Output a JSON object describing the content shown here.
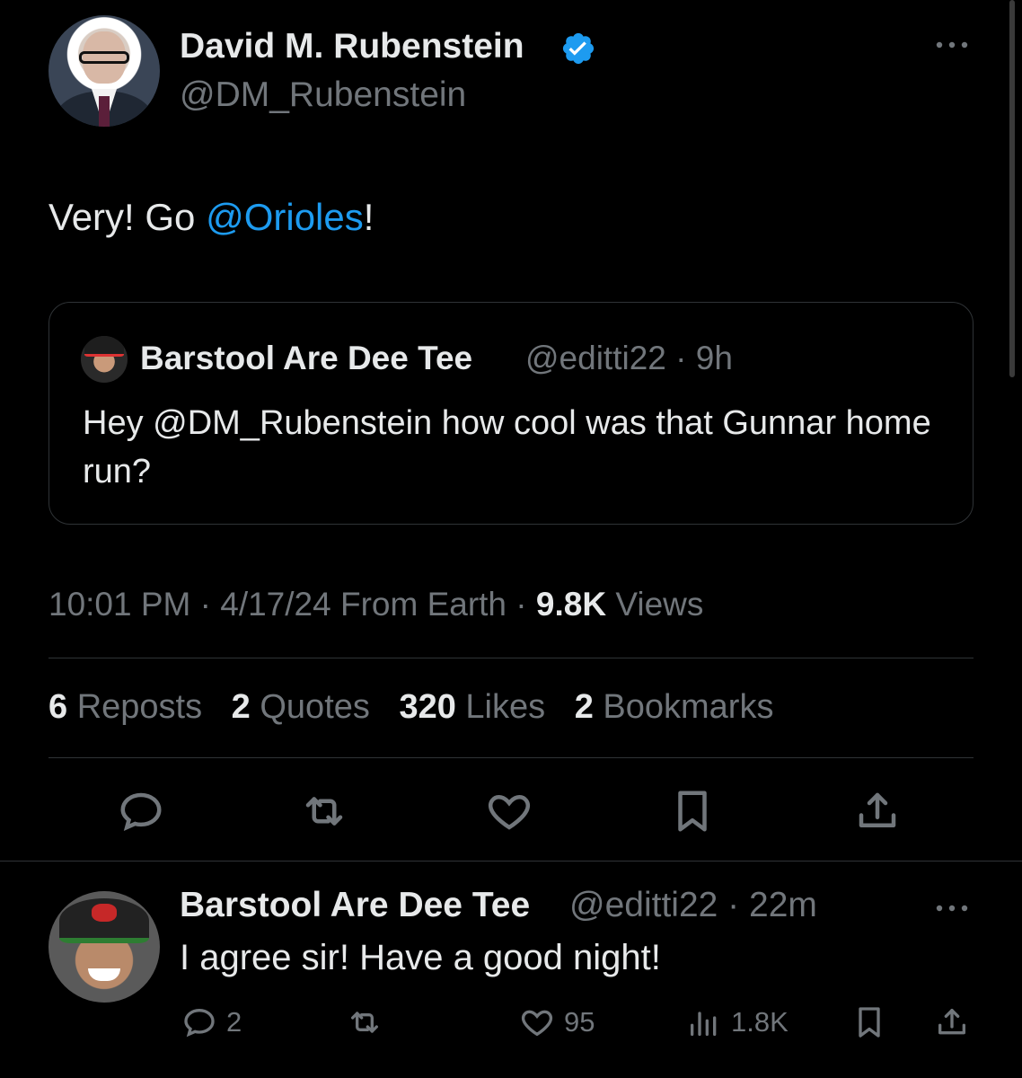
{
  "tweet": {
    "author_name": "David M. Rubenstein",
    "author_handle": "@DM_Rubenstein",
    "text_before": "Very! Go ",
    "text_mention": "@Orioles",
    "text_after": "!",
    "timestamp": "10:01 PM · 4/17/24 From Earth · ",
    "views_count": "9.8K",
    "views_label": " Views",
    "verified_color": "#1d9bf0"
  },
  "quote": {
    "author_name": "Barstool Are Dee Tee",
    "author_meta": "@editti22 · 9h",
    "text": "Hey @DM_Rubenstein how cool was that Gunnar home run?"
  },
  "stats": {
    "reposts_count": "6",
    "reposts_label": " Reposts",
    "quotes_count": "2",
    "quotes_label": " Quotes",
    "likes_count": "320",
    "likes_label": " Likes",
    "bookmarks_count": "2",
    "bookmarks_label": " Bookmarks"
  },
  "actions": [
    "reply-icon",
    "repost-icon",
    "like-icon",
    "bookmark-icon",
    "share-icon"
  ],
  "reply": {
    "author_name": "Barstool Are Dee Tee",
    "author_meta": "@editti22 · 22m",
    "text": "I agree sir! Have a good night!",
    "reply_count": "2",
    "like_count": "95",
    "view_count": "1.8K"
  },
  "colors": {
    "background": "#000000",
    "text": "#e7e9ea",
    "muted": "#71767b",
    "link": "#1d9bf0",
    "border": "#2f3336"
  }
}
